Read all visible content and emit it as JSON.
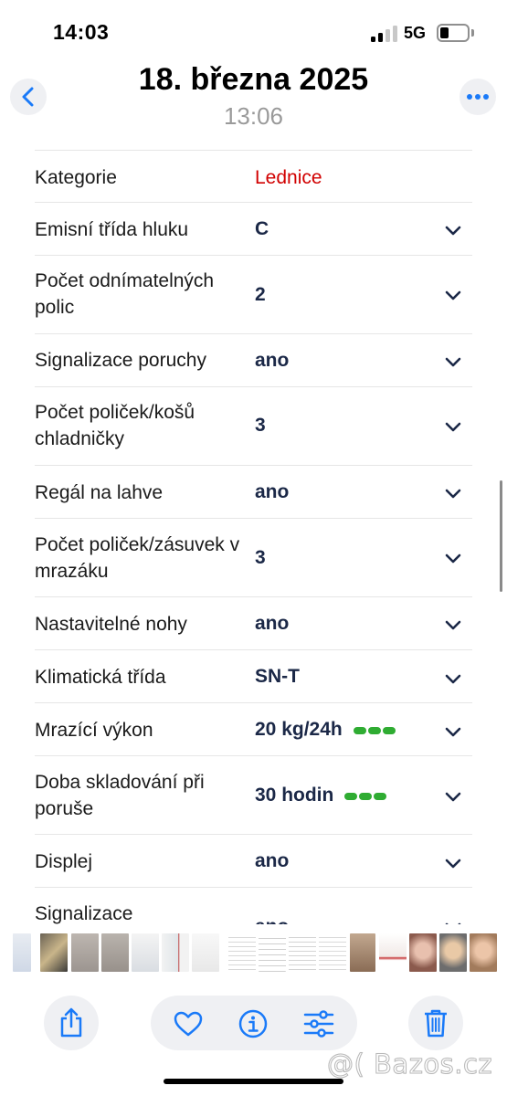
{
  "status_bar": {
    "time": "14:03",
    "network": "5G",
    "signal_bars_filled": 2,
    "signal_bars_total": 4,
    "battery_level": 0.25
  },
  "header": {
    "title": "18. března 2025",
    "subtitle": "13:06",
    "back_icon": "chevron-left-icon",
    "more_icon": "ellipsis-icon"
  },
  "table": {
    "rows": [
      {
        "label": "Kategorie",
        "value": "Lednice",
        "value_color": "#d10000",
        "expandable": false
      },
      {
        "label": "Emisní třída hluku",
        "value": "C",
        "expandable": true
      },
      {
        "label": "Počet odnímatelných polic",
        "value": "2",
        "expandable": true
      },
      {
        "label": "Signalizace poruchy",
        "value": "ano",
        "expandable": true
      },
      {
        "label": "Počet poliček/košů chladničky",
        "value": "3",
        "expandable": true
      },
      {
        "label": "Regál na lahve",
        "value": "ano",
        "expandable": true
      },
      {
        "label": "Počet poliček/zásuvek v mrazáku",
        "value": "3",
        "expandable": true
      },
      {
        "label": "Nastavitelné nohy",
        "value": "ano",
        "expandable": true
      },
      {
        "label": "Klimatická třída",
        "value": "SN-T",
        "expandable": true
      },
      {
        "label": "Mrazící výkon",
        "value": "20 kg/24h",
        "rating_dots": 3,
        "expandable": true
      },
      {
        "label": "Doba skladování při poruše",
        "value": "30 hodin",
        "rating_dots": 3,
        "expandable": true
      },
      {
        "label": "Displej",
        "value": "ano",
        "expandable": true
      },
      {
        "label": "Signalizace",
        "value": "ano",
        "expandable": true
      }
    ]
  },
  "thumbnails": {
    "count": 20
  },
  "toolbar": {
    "share_icon": "share-icon",
    "favorite_icon": "heart-icon",
    "info_icon": "info-icon",
    "adjust_icon": "sliders-icon",
    "delete_icon": "trash-icon"
  },
  "watermark": {
    "text": "@( Bazos.cz"
  },
  "colors": {
    "accent": "#1a7af8",
    "value_text": "#1b2847",
    "category_red": "#d10000",
    "rating_green": "#2fac32"
  }
}
